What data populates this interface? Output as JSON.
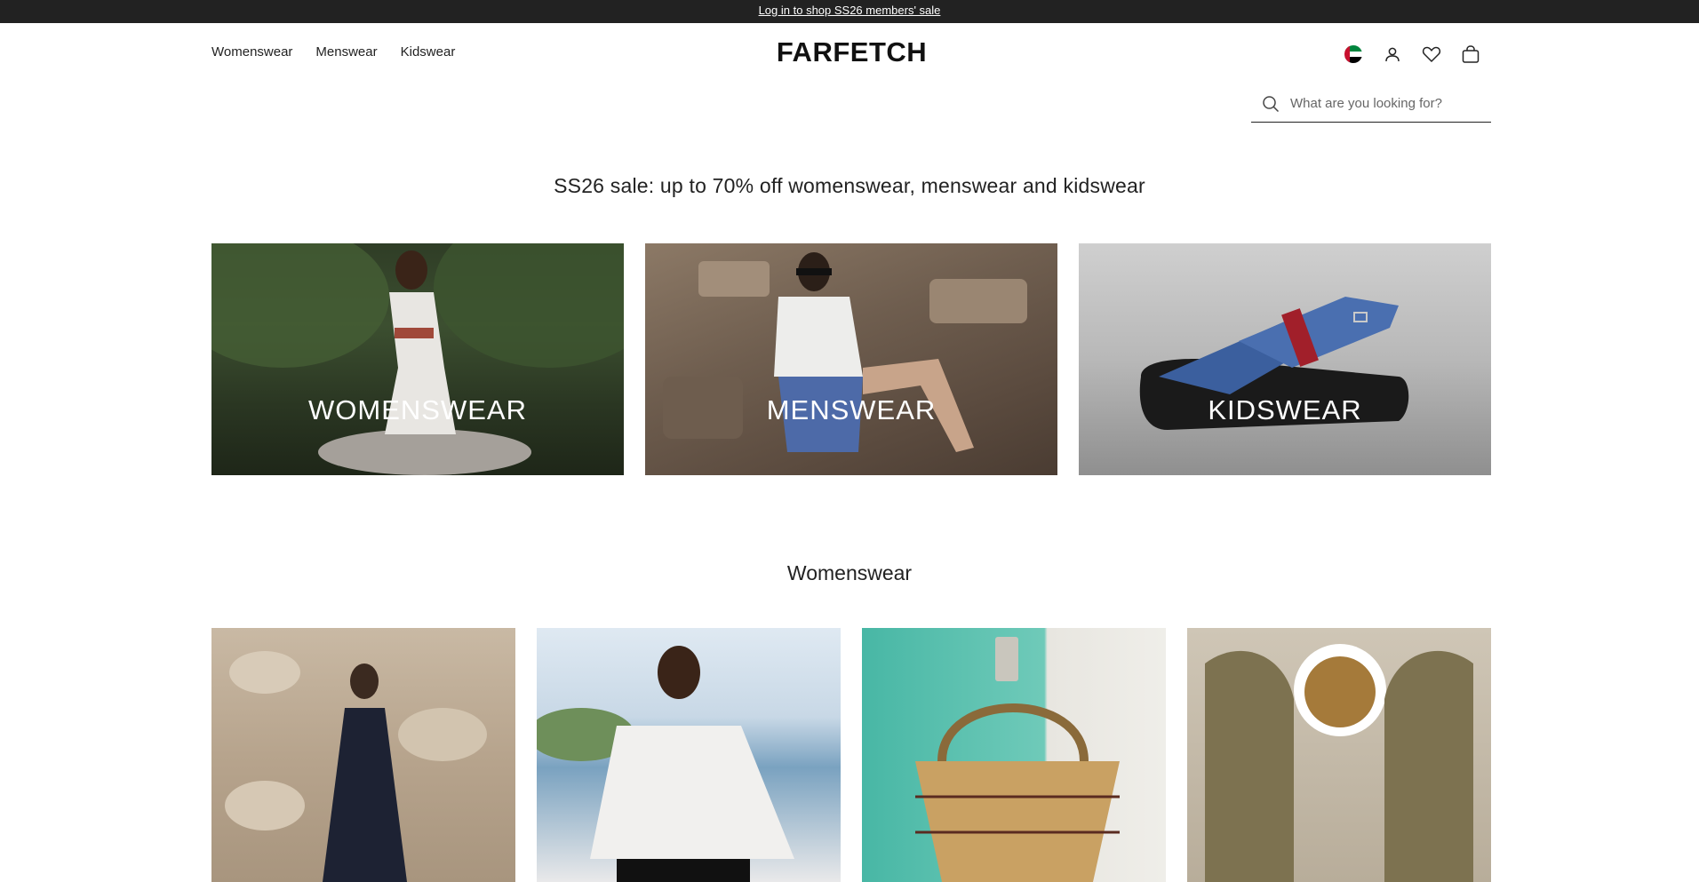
{
  "promo": {
    "link_text": "Log in to shop SS26 members' sale"
  },
  "nav": {
    "items": [
      "Womenswear",
      "Menswear",
      "Kidswear"
    ]
  },
  "brand": {
    "logo_text": "FARFETCH"
  },
  "header_icons": [
    "uae-flag-icon",
    "account-icon",
    "wishlist-heart-icon",
    "shopping-bag-icon"
  ],
  "search": {
    "placeholder": "What are you looking for?"
  },
  "headline": "SS26 sale: up to 70% off womenswear, menswear and kidswear",
  "categories": [
    {
      "label": "WOMENSWEAR"
    },
    {
      "label": "MENSWEAR"
    },
    {
      "label": "KIDSWEAR"
    }
  ],
  "section": {
    "title": "Womenswear"
  },
  "colors": {
    "promo_bar_bg": "#222222",
    "text": "#222222",
    "background": "#ffffff"
  }
}
